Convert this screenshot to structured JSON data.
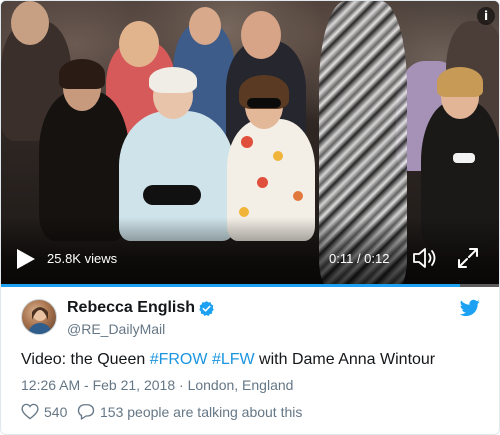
{
  "video": {
    "views": "25.8K views",
    "time": "0:11 / 0:12",
    "progress": 0.917,
    "info_glyph": "i",
    "icons": [
      "play-icon",
      "volume-icon",
      "fullscreen-icon",
      "info-icon"
    ]
  },
  "author": {
    "display_name": "Rebecca English",
    "handle": "@RE_DailyMail",
    "verified": true
  },
  "tweet": {
    "text_prefix": "Video: the Queen ",
    "hashtag_1": "#FROW",
    "space": " ",
    "hashtag_2": "#LFW",
    "text_suffix": " with Dame Anna Wintour"
  },
  "meta": {
    "time": "12:26 AM - Feb 21, 2018",
    "separator": " · ",
    "location": "London, England"
  },
  "stats": {
    "likes": "540",
    "replies_text": "153 people are talking about this"
  },
  "colors": {
    "accent": "#1da1f2",
    "hashtag": "#1b95e0",
    "secondary_text": "#657786",
    "primary_text": "#14171a"
  }
}
